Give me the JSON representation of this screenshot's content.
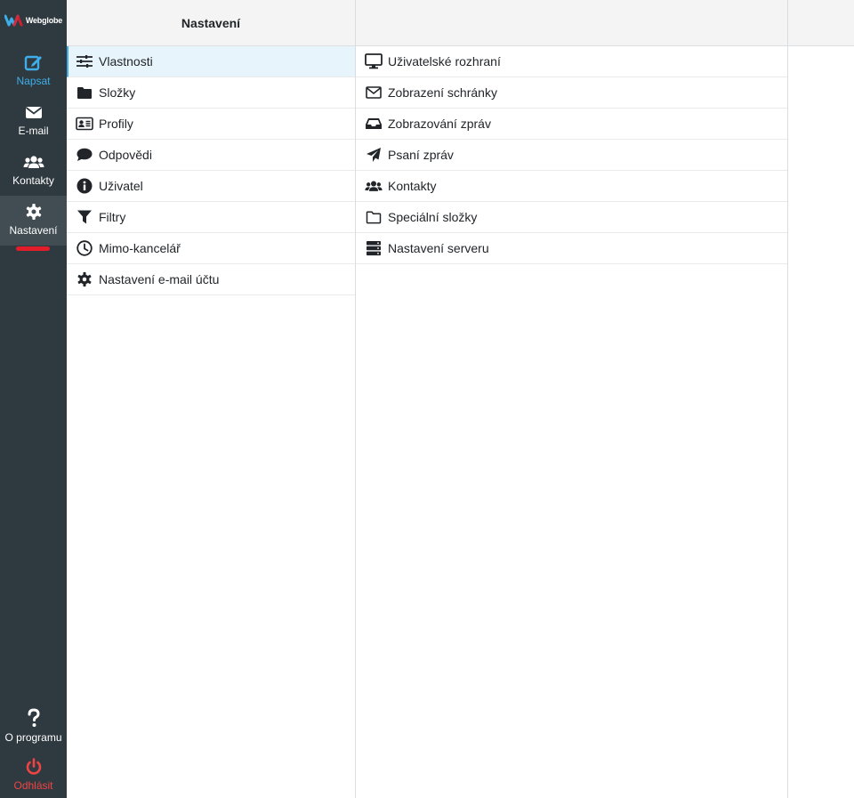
{
  "brand": {
    "name": "Webglobe"
  },
  "rail": {
    "compose": "Napsat",
    "email": "E-mail",
    "contacts": "Kontakty",
    "settings": "Nastavení",
    "about": "O programu",
    "logout": "Odhlásit"
  },
  "settings_column": {
    "title": "Nastavení",
    "items": [
      {
        "label": "Vlastnosti",
        "icon": "sliders-icon"
      },
      {
        "label": "Složky",
        "icon": "folder-icon"
      },
      {
        "label": "Profily",
        "icon": "id-card-icon"
      },
      {
        "label": "Odpovědi",
        "icon": "comment-icon"
      },
      {
        "label": "Uživatel",
        "icon": "info-icon"
      },
      {
        "label": "Filtry",
        "icon": "filter-icon"
      },
      {
        "label": "Mimo-kancelář",
        "icon": "clock-icon"
      },
      {
        "label": "Nastavení e-mail účtu",
        "icon": "gear-icon"
      }
    ]
  },
  "properties_column": {
    "items": [
      {
        "label": "Uživatelské rozhraní",
        "icon": "monitor-icon"
      },
      {
        "label": "Zobrazení schránky",
        "icon": "envelope-icon"
      },
      {
        "label": "Zobrazování zpráv",
        "icon": "inbox-icon"
      },
      {
        "label": "Psaní zpráv",
        "icon": "paper-plane-icon"
      },
      {
        "label": "Kontakty",
        "icon": "users-icon"
      },
      {
        "label": "Speciální složky",
        "icon": "folder-outline-icon"
      },
      {
        "label": "Nastavení serveru",
        "icon": "server-icon"
      }
    ]
  },
  "colors": {
    "rail_bg": "#2f3a40",
    "accent": "#3daee9",
    "active_marker": "#e11d2a",
    "logout": "#ef4444",
    "selected_row": "#e8f4fb"
  }
}
